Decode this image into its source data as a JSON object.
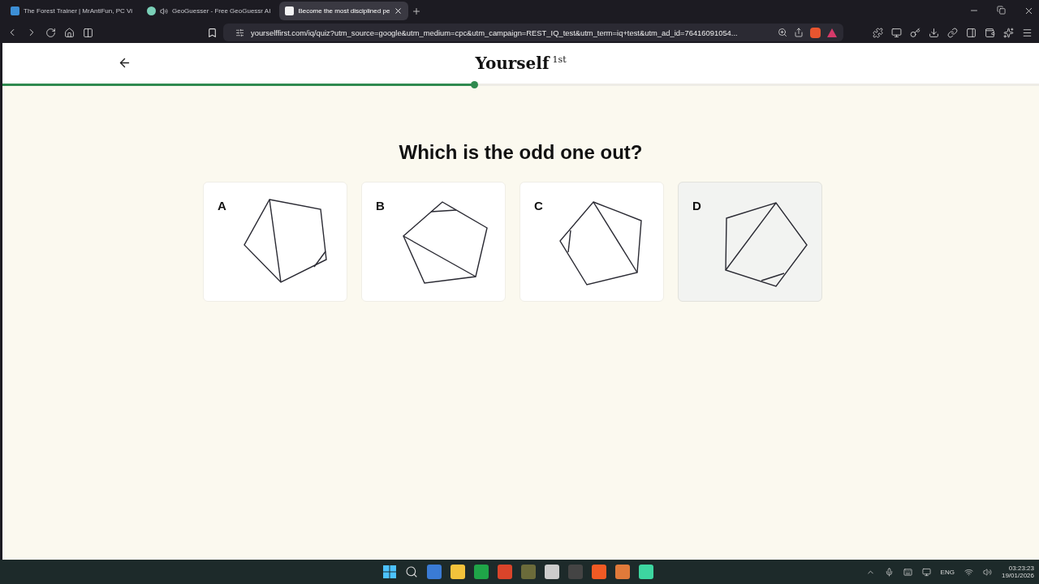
{
  "browser": {
    "tabs": [
      {
        "title": "The Forest Trainer | MrAntiFun, PC Vi",
        "selected": false,
        "audio": false
      },
      {
        "title": "GeoGuesser - Free GeoGuessr AI",
        "selected": false,
        "audio": true
      },
      {
        "title": "Become the most disciplined pe",
        "selected": true,
        "audio": false
      }
    ],
    "url": "yourselffirst.com/iq/quiz?utm_source=google&utm_medium=cpc&utm_campaign=REST_IQ_test&utm_term=iq+test&utm_ad_id=76416091054..."
  },
  "header": {
    "brand": "Yourself",
    "brand_sup": "1st",
    "progress": {
      "level": 0.455
    }
  },
  "question": "Which is the odd one out?",
  "options": [
    {
      "letter": "A",
      "hovered": false
    },
    {
      "letter": "B",
      "hovered": false
    },
    {
      "letter": "C",
      "hovered": false
    },
    {
      "letter": "D",
      "hovered": true
    }
  ],
  "taskbar": {
    "language": "ENG",
    "time": "03:23:23",
    "date": "19/01/2026"
  }
}
